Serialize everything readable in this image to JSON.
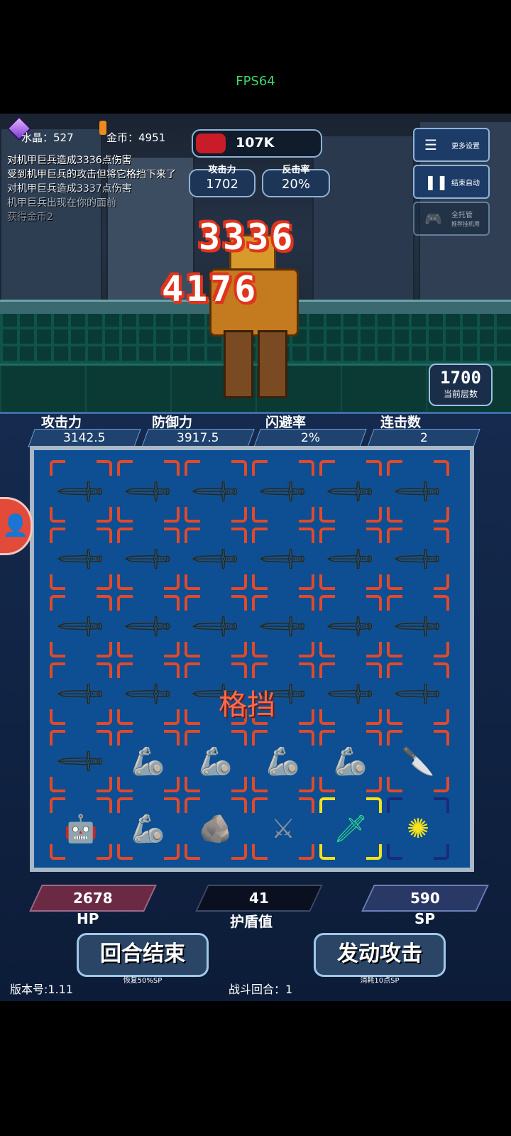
{
  "status": {
    "fps": "FPS64"
  },
  "resources": {
    "crystal": "水晶：527",
    "gold": "金币：4951"
  },
  "log": [
    "对机甲巨兵造成3336点伤害",
    "受到机甲巨兵的攻击但将它格挡下来了",
    "对机甲巨兵造成3337点伤害",
    "机甲巨兵出现在你的面前",
    "获得金币2"
  ],
  "enemy": {
    "hp_text": "107K",
    "hp_fraction": 0.25,
    "attack_label": "攻击力",
    "attack_value": "1702",
    "counter_label": "反击率",
    "counter_value": "20%"
  },
  "menu": {
    "more_settings": "更多设置",
    "end_auto": "结束自动",
    "full_auto": "全托管",
    "full_auto_sub": "推荐挂机用"
  },
  "damage_numbers": [
    "3336",
    "4176"
  ],
  "floor": {
    "value": "1700",
    "label": "当前层数"
  },
  "player_stats": [
    {
      "label": "攻击力",
      "value": "3142.5"
    },
    {
      "label": "防御力",
      "value": "3917.5"
    },
    {
      "label": "闪避率",
      "value": "2%"
    },
    {
      "label": "连击数",
      "value": "2"
    }
  ],
  "grid_popup": "格挡",
  "grid": [
    [
      "sword",
      "sword",
      "sword",
      "sword",
      "sword",
      "sword"
    ],
    [
      "sword",
      "sword",
      "sword",
      "sword",
      "sword",
      "sword"
    ],
    [
      "sword",
      "sword",
      "sword",
      "sword",
      "sword",
      "sword"
    ],
    [
      "sword",
      "sword",
      "sword",
      "sword",
      "sword",
      "sword"
    ],
    [
      "sword",
      "gauntlet",
      "gauntlet",
      "gauntlet",
      "gauntlet",
      "knife"
    ],
    [
      "armor-robot",
      "gauntlet",
      "rock",
      "dark-blade",
      "green-sword",
      "yellow-sun"
    ]
  ],
  "vitals": {
    "hp": "2678",
    "hp_label": "HP",
    "shield": "41",
    "shield_label": "护盾值",
    "sp": "590",
    "sp_label": "SP"
  },
  "actions": {
    "end_turn": "回合结束",
    "end_turn_sub": "恢复50%SP",
    "attack": "发动攻击",
    "attack_sub": "消耗10点SP"
  },
  "footer": {
    "version": "版本号:1.11",
    "round": "战斗回合：1"
  },
  "colors": {
    "accent_red": "#e0341c",
    "corner_orange": "#e2492a",
    "corner_yellow": "#f2e21c",
    "panel_blue": "#0d4f92"
  }
}
